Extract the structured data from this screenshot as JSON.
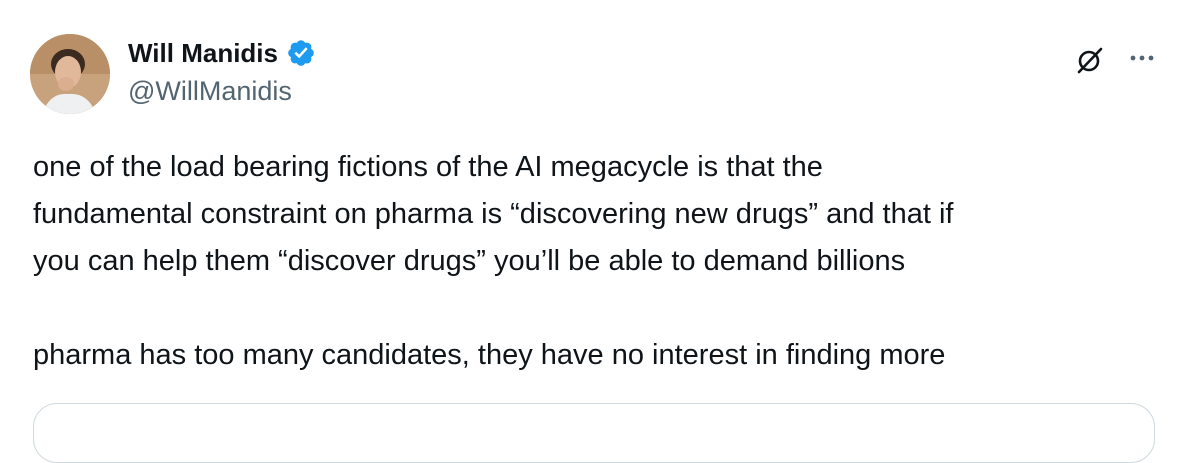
{
  "author": {
    "display_name": "Will Manidis",
    "handle": "@WillManidis",
    "verified": true
  },
  "tweet": {
    "lines": [
      "one of the load bearing fictions of the AI megacycle is that the",
      "fundamental constraint on pharma is “discovering new drugs” and that if",
      "you can help them “discover drugs” you’ll be able to demand billions",
      "",
      "pharma has too many candidates, they have no interest in finding more"
    ]
  },
  "icons": {
    "verified": "verified-badge-icon",
    "grok": "grok-icon",
    "more": "more-horizontal-icon"
  },
  "colors": {
    "text": "#0f1419",
    "secondary": "#536471",
    "verified_blue": "#1d9bf0",
    "border": "#cfd9de"
  }
}
